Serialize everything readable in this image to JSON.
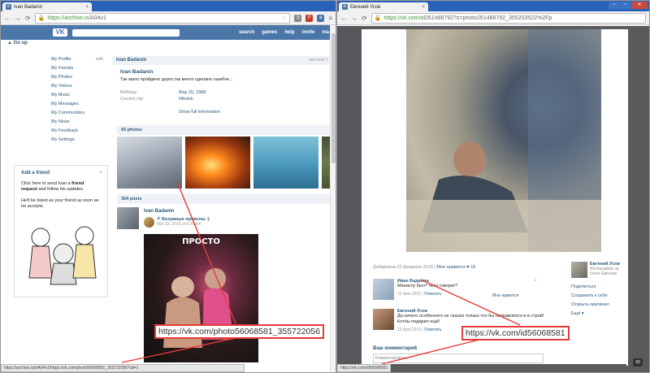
{
  "left": {
    "tab_title": "Ivan Badanin",
    "url_host": "https://archive.is",
    "url_path": "/A04v1",
    "go_up": "Go up",
    "top_menu": [
      "search",
      "games",
      "help",
      "invite",
      "ma"
    ],
    "side_menu": [
      "My Profile",
      "My Friends",
      "My Photos",
      "My Videos",
      "My Music",
      "My Messages",
      "My Communities",
      "My News",
      "My Feedback",
      "My Settings"
    ],
    "edit": "edit",
    "profile_head": "Ivan Badanin",
    "last_seen": "last seen t",
    "name": "Ivan Badanin",
    "status": "Так мало пройдено дорог,так много сделано ошибок...",
    "birthday_label": "Birthday:",
    "birthday": "May 25, 1988",
    "city_label": "Current city:",
    "city": "Nikolsk",
    "show_full": "Show full information",
    "photos_head": "93 photos",
    "posts_head": "304 posts",
    "post_author": "Ivan Badanin",
    "repost_name": "Безумные приколы :)",
    "repost_date": "Mar 15, 2015 at 6:26 pm",
    "meme_caption": "ПРОСТО",
    "friend_box": {
      "title": "Add a friend",
      "p1a": "Click here to send Ivan a ",
      "p1b": "friend request",
      "p1c": " and follow his updates.",
      "p2": "He'll be listed as your friend as soon as he accepts."
    },
    "status_url": "https://archive.is/o/A04v1/https://vk.com/photo56068581_355722056?all=1",
    "callout": "https://vk.com/photo56068581_355722056"
  },
  "right": {
    "tab_title": "Евгений Усов",
    "url_host": "https://vk.com",
    "url_path": "/id261488792?z=photo261488792_355203522%2Fp",
    "added": "Добавлена 22 февраля 2015",
    "like_label": "Мне нравится",
    "like_count": "16",
    "comments": [
      {
        "name": "Иван Баданин",
        "text": "Министр был? Чего говорит?",
        "date": "22 фев 2015",
        "reply": "Ответить",
        "like": "Мне нравится"
      },
      {
        "name": "Евгений Усов",
        "text": "Да ничего особенного не сказал только что бы поправлялся и в строй! Котлы подарил ещё!",
        "date": "22 фев 2015",
        "reply": "Ответить"
      }
    ],
    "your_comment": "Ваш комментарий",
    "comment_placeholder": "Комментировать...",
    "side_name": "Евгений Усов",
    "side_sub": "Фотографии на стене Евгения",
    "actions": [
      "Поделиться",
      "Сохранить к себе",
      "Открыть оригинал",
      "Ещё"
    ],
    "status_url": "https://vk.com/id56068581",
    "callout": "https://vk.com/id56068581",
    "counter": "62"
  },
  "colors": {
    "vk_blue": "#4a76a8",
    "link": "#2b587a",
    "callout_border": "#e53a3a",
    "chrome_frame": "#2a62b8"
  }
}
